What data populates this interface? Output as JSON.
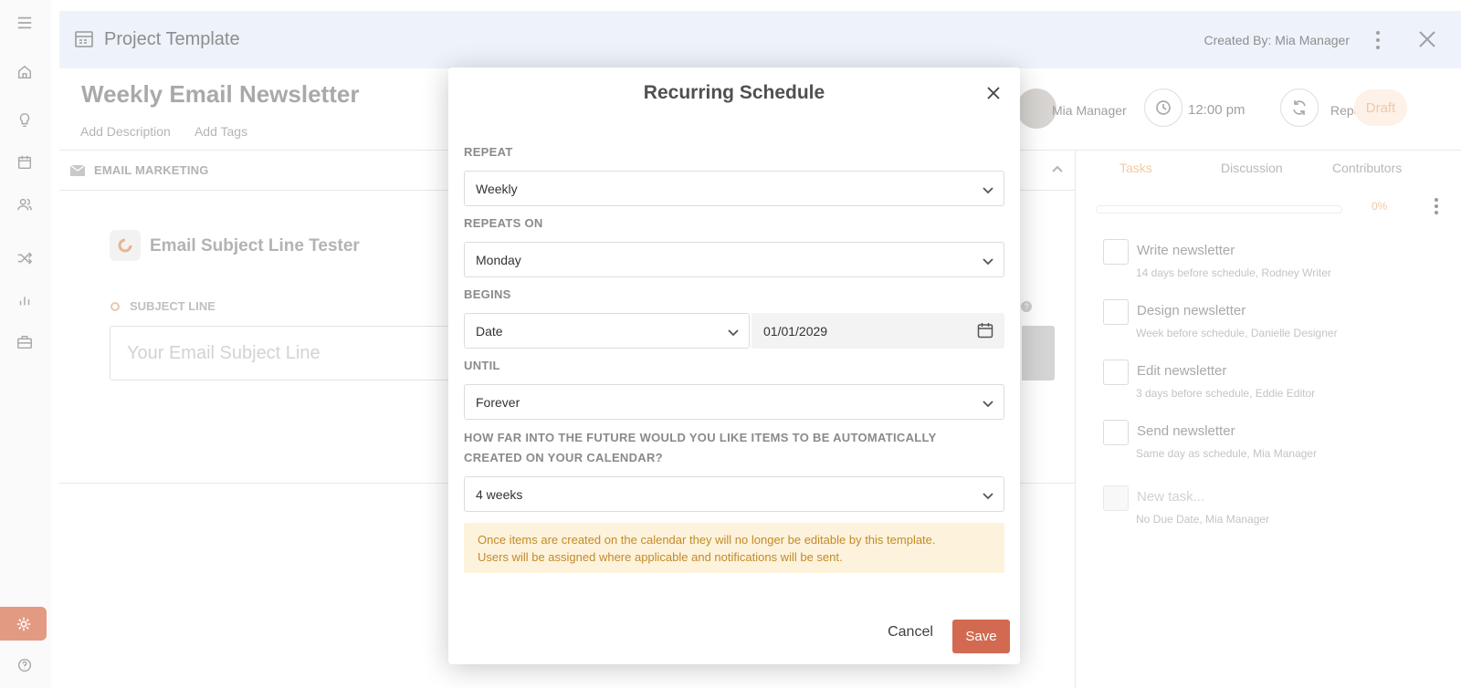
{
  "panel": {
    "template_label": "Project Template",
    "created_by": "Created By: Mia Manager",
    "item_title": "Weekly Email Newsletter",
    "add_description": "Add Description",
    "add_tags": "Add Tags",
    "owner": "Mia Manager",
    "time": "12:00 pm",
    "repeat": "Repeat",
    "status": "Draft",
    "section": "EMAIL MARKETING",
    "tester_title": "Email Subject Line Tester",
    "subject_label": "SUBJECT LINE",
    "subject_placeholder": "Your Email Subject Line"
  },
  "tasks_panel": {
    "tabs": [
      "Tasks",
      "Discussion",
      "Contributors"
    ],
    "active_tab": "Tasks",
    "progress_label": "0%",
    "progress": 0,
    "tasks": [
      {
        "name": "Write newsletter",
        "meta": "14 days before schedule,  Rodney Writer"
      },
      {
        "name": "Design newsletter",
        "meta": "Week before schedule,  Danielle Designer"
      },
      {
        "name": "Edit newsletter",
        "meta": "3 days before schedule,  Eddie Editor"
      },
      {
        "name": "Send newsletter",
        "meta": "Same day as schedule,  Mia Manager"
      },
      {
        "name": "New task...",
        "meta": "No Due Date,  Mia Manager"
      }
    ]
  },
  "modal": {
    "title": "Recurring Schedule",
    "repeat_label": "REPEAT",
    "repeat_value": "Weekly",
    "repeats_on_label": "REPEATS ON",
    "repeats_on_value": "Monday",
    "begins_label": "BEGINS",
    "begins_type": "Date",
    "begins_date": "01/01/2029",
    "until_label": "UNTIL",
    "until_value": "Forever",
    "future_label_line1": "HOW FAR INTO THE FUTURE WOULD YOU LIKE ITEMS TO BE AUTOMATICALLY",
    "future_label_line2": "CREATED ON YOUR CALENDAR?",
    "future_value": "4 weeks",
    "notice_line1": "Once items are created on the calendar they will no longer be editable by this template.",
    "notice_line2": "Users will be assigned where applicable and notifications will be sent.",
    "cancel": "Cancel",
    "save": "Save"
  },
  "colors": {
    "accent": "#d26a51",
    "notice_bg": "#fdf3dc",
    "notice_text": "#c28a2a",
    "header_bg": "#eef3fb"
  }
}
